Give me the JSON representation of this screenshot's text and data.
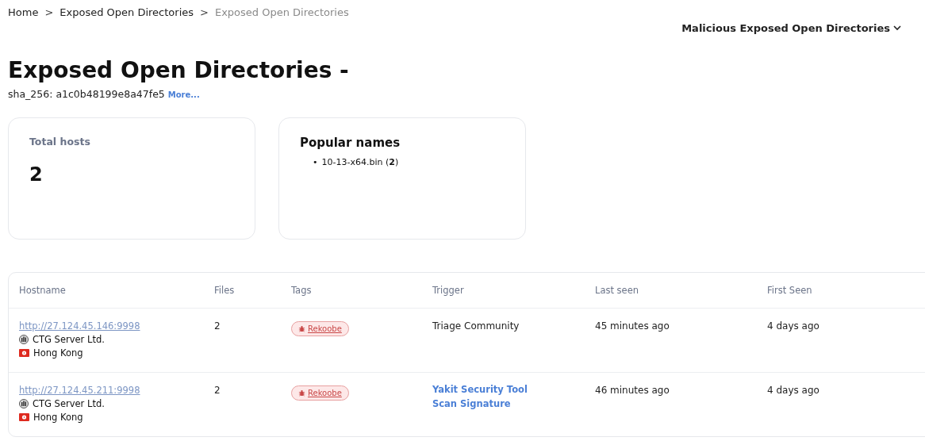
{
  "breadcrumb": [
    {
      "label": "Home",
      "current": false
    },
    {
      "label": "Exposed Open Directories",
      "current": false
    },
    {
      "label": "Exposed Open Directories",
      "current": true
    }
  ],
  "breadcrumb_separator": ">",
  "category_dropdown": {
    "label": "Malicious Exposed Open Directories"
  },
  "title": "Exposed Open Directories -",
  "hash": {
    "label": "sha_256: a1c0b48199e8a47fe5",
    "more_link": "More..."
  },
  "total_hosts": {
    "label": "Total hosts",
    "value": "2"
  },
  "popular_names": {
    "title": "Popular names",
    "items": [
      {
        "bullet": "•",
        "text": "10-13-x64.bin (**2**)"
      }
    ]
  },
  "table": {
    "columns": [
      "Hostname",
      "Files",
      "Tags",
      "Trigger",
      "Last seen",
      "First Seen"
    ],
    "rows": [
      {
        "url": "http://27.124.45.146:9998",
        "org": "CTG Server Ltd.",
        "country": "Hong Kong",
        "files": "2",
        "tags": [
          "Rekoobe"
        ],
        "trigger": {
          "kind": "text",
          "text": "Triage Community"
        },
        "last_seen": "45 minutes ago",
        "first_seen": "4 days ago"
      },
      {
        "url": "http://27.124.45.211:9998",
        "org": "CTG Server Ltd.",
        "country": "Hong Kong",
        "files": "2",
        "tags": [
          "Rekoobe"
        ],
        "trigger": {
          "kind": "link",
          "text": "Yakit Security Tool Scan Signature"
        },
        "last_seen": "46 minutes ago",
        "first_seen": "4 days ago"
      }
    ]
  }
}
